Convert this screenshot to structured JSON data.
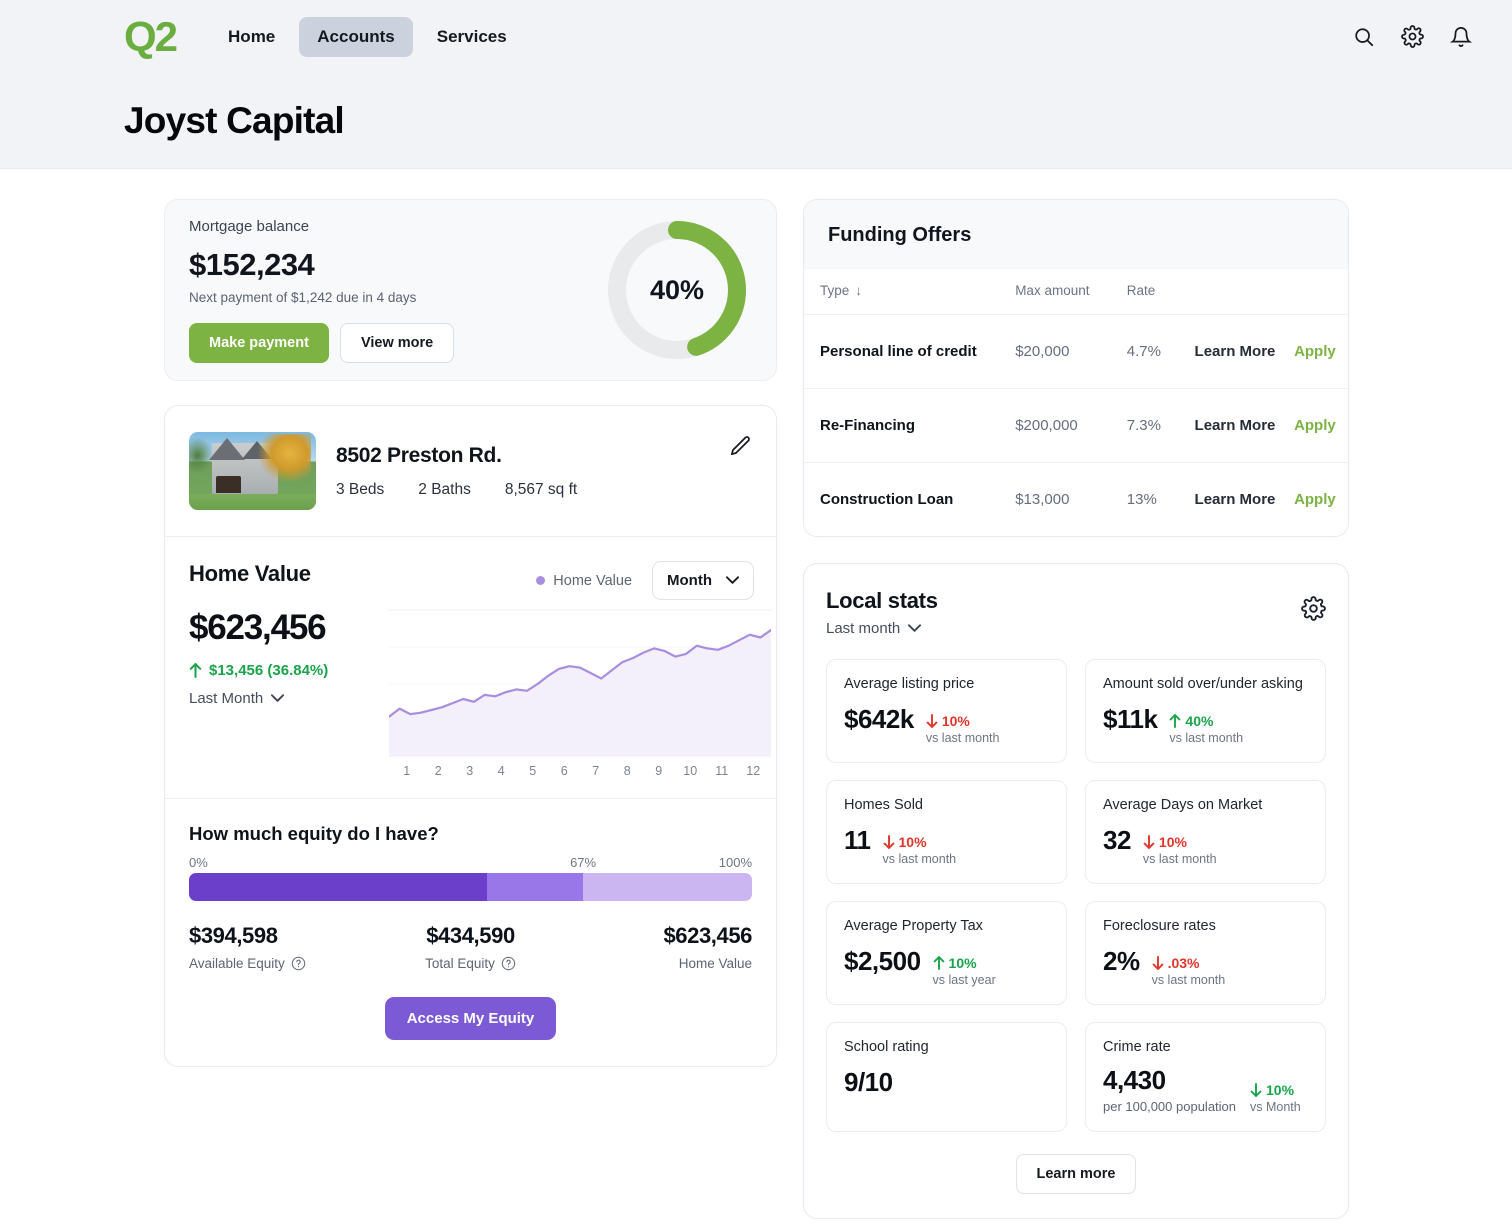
{
  "nav": {
    "logo": "Q2",
    "links": [
      {
        "label": "Home",
        "active": false
      },
      {
        "label": "Accounts",
        "active": true
      },
      {
        "label": "Services",
        "active": false
      }
    ],
    "icons": [
      "search-icon",
      "gear-icon",
      "bell-icon"
    ]
  },
  "page": {
    "title": "Joyst Capital"
  },
  "mortgage": {
    "label": "Mortgage balance",
    "amount": "$152,234",
    "next_payment": "Next payment of $1,242 due in 4 days",
    "primary_button": "Make payment",
    "secondary_button": "View more",
    "progress_label": "40%",
    "progress_value": 40,
    "progress_color": "#7cb342",
    "track_color": "#e8eaec"
  },
  "property": {
    "address": "8502 Preston Rd.",
    "beds": "3 Beds",
    "baths": "2 Baths",
    "sqft": "8,567 sq ft",
    "edit_icon": "pencil-icon"
  },
  "home_value": {
    "title": "Home Value",
    "legend_label": "Home Value",
    "legend_color": "#a98ee0",
    "range_selected": "Month",
    "amount": "$623,456",
    "change": "$13,456 (36.84%)",
    "change_direction": "up",
    "change_color": "#19a34a",
    "period": "Last Month"
  },
  "equity": {
    "title": "How much equity do I have?",
    "scale_min": "0%",
    "scale_mid": "67%",
    "scale_max": "100%",
    "segments": [
      {
        "name": "available",
        "pct": 53,
        "color": "#6b3fc9"
      },
      {
        "name": "total",
        "pct": 17,
        "color": "#9a77e8"
      },
      {
        "name": "home",
        "pct": 30,
        "color": "#ccb6f2"
      }
    ],
    "available_value": "$394,598",
    "available_label": "Available Equity",
    "total_value": "$434,590",
    "total_label": "Total Equity",
    "home_value": "$623,456",
    "home_label": "Home Value",
    "button": "Access My Equity"
  },
  "funding_offers": {
    "title": "Funding Offers",
    "columns": [
      "Type",
      "Max amount",
      "Rate"
    ],
    "sort_icon": "arrow-down-icon",
    "rows": [
      {
        "type": "Personal line of credit",
        "max": "$20,000",
        "rate": "4.7%",
        "learn": "Learn More",
        "apply": "Apply"
      },
      {
        "type": "Re-Financing",
        "max": "$200,000",
        "rate": "7.3%",
        "learn": "Learn More",
        "apply": "Apply"
      },
      {
        "type": "Construction Loan",
        "max": "$13,000",
        "rate": "13%",
        "learn": "Learn More",
        "apply": "Apply"
      }
    ]
  },
  "local_stats": {
    "title": "Local stats",
    "period": "Last month",
    "settings_icon": "gear-icon",
    "cards": [
      {
        "label": "Average listing price",
        "value": "$642k",
        "delta": "10%",
        "direction": "down",
        "tone": "bad",
        "vs": "vs last month"
      },
      {
        "label": "Amount sold over/under asking",
        "value": "$11k",
        "delta": "40%",
        "direction": "up",
        "tone": "good",
        "vs": "vs last month"
      },
      {
        "label": "Homes Sold",
        "value": "11",
        "delta": "10%",
        "direction": "down",
        "tone": "bad",
        "vs": "vs last month"
      },
      {
        "label": "Average Days on Market",
        "value": "32",
        "delta": "10%",
        "direction": "down",
        "tone": "bad",
        "vs": "vs last month"
      },
      {
        "label": "Average Property Tax",
        "value": "$2,500",
        "delta": "10%",
        "direction": "up",
        "tone": "good",
        "vs": "vs last year"
      },
      {
        "label": "Foreclosure rates",
        "value": "2%",
        "delta": ".03%",
        "direction": "down",
        "tone": "bad",
        "vs": "vs last month"
      }
    ],
    "school": {
      "label": "School rating",
      "value": "9/10"
    },
    "crime": {
      "label": "Crime rate",
      "value": "4,430",
      "sub": "per 100,000 population",
      "delta": "10%",
      "direction": "down",
      "tone": "good",
      "vs": "vs Month"
    },
    "button": "Learn more"
  },
  "chart_data": {
    "type": "area",
    "title": "Home Value",
    "xlabel": "",
    "ylabel": "",
    "series": [
      {
        "name": "Home Value",
        "color": "#a98ee0",
        "values": [
          560000,
          566000,
          562000,
          563000,
          565000,
          567000,
          570000,
          573000,
          571000,
          576000,
          575000,
          578000,
          580000,
          579000,
          584000,
          590000,
          595000,
          597000,
          596000,
          592000,
          588000,
          594000,
          600000,
          603000,
          607000,
          610000,
          608000,
          604000,
          606000,
          612000,
          610000,
          609000,
          612000,
          616000,
          620000,
          618000,
          623456
        ]
      }
    ],
    "xticks": [
      "1",
      "2",
      "3",
      "4",
      "5",
      "6",
      "7",
      "8",
      "9",
      "10",
      "11",
      "12"
    ],
    "grid": true,
    "legend_position": "top-right"
  }
}
